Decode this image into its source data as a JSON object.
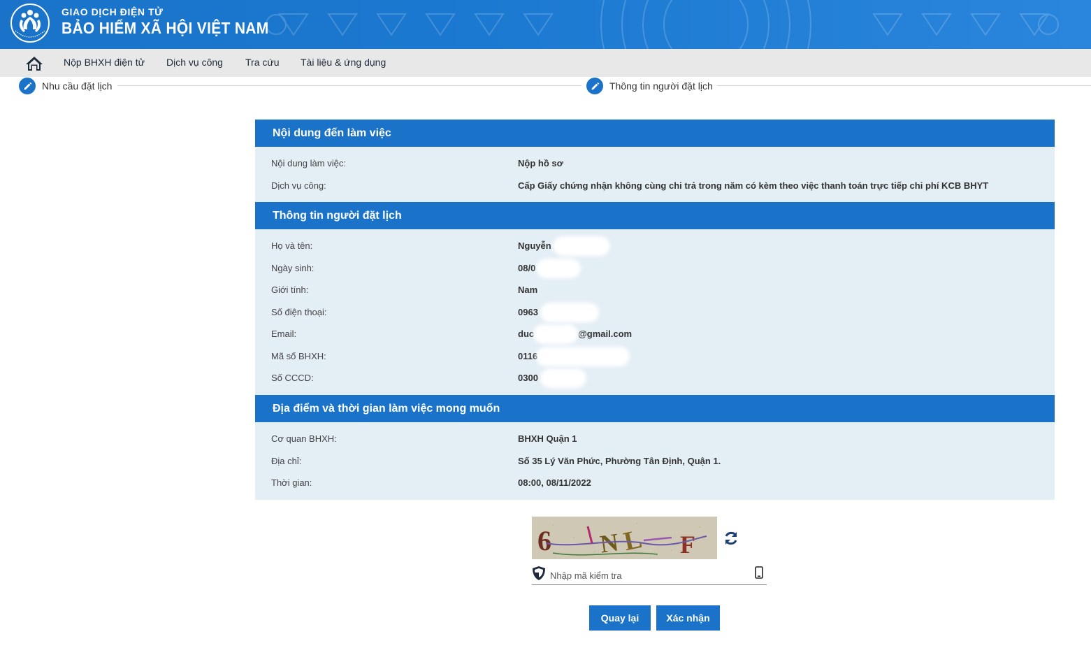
{
  "header": {
    "brand_top": "GIAO DỊCH ĐIỆN TỬ",
    "brand_main": "BẢO HIỂM XÃ HỘI VIỆT NAM",
    "logo_ring_text": "BẢO HIỂM XÃ HỘI VIỆT NAM",
    "color": "#1a73c8"
  },
  "nav": {
    "home_icon": "home-icon",
    "items": [
      "Nộp BHXH điện tử",
      "Dịch vụ công",
      "Tra cứu",
      "Tài liệu & ứng dụng"
    ]
  },
  "steps": [
    {
      "label": "Nhu cầu đặt lịch",
      "icon": "pencil-icon"
    },
    {
      "label": "Thông tin người đặt lịch",
      "icon": "pencil-icon"
    }
  ],
  "sections": [
    {
      "title": "Nội dung đến làm việc",
      "rows": [
        {
          "label": "Nội dung làm việc:",
          "value": "Nộp hồ sơ"
        },
        {
          "label": "Dịch vụ công:",
          "value": "Cấp Giấy chứng nhận không cùng chi trả trong năm có kèm theo việc thanh toán trực tiếp chi phí KCB BHYT"
        }
      ]
    },
    {
      "title": "Thông tin người đặt lịch",
      "rows": [
        {
          "label": "Họ và tên:",
          "value": "Nguyễn"
        },
        {
          "label": "Ngày sinh:",
          "value": "08/0"
        },
        {
          "label": "Giới tính:",
          "value": "Nam"
        },
        {
          "label": "Số điện thoại:",
          "value": "0963"
        },
        {
          "label": "Email:",
          "value": "duc",
          "value_suffix": "@gmail.com"
        },
        {
          "label": "Mã số BHXH:",
          "value": "0116"
        },
        {
          "label": "Số CCCD:",
          "value": "0300"
        }
      ]
    },
    {
      "title": "Địa điểm và thời gian làm việc mong muốn",
      "rows": [
        {
          "label": "Cơ quan BHXH:",
          "value": "BHXH Quận 1"
        },
        {
          "label": "Địa chỉ:",
          "value": "Số 35 Lý Văn Phức, Phường Tân Định, Quận 1."
        },
        {
          "label": "Thời gian:",
          "value": "08:00, 08/11/2022"
        }
      ]
    }
  ],
  "captcha": {
    "text": "6NLF",
    "placeholder": "Nhập mã kiểm tra",
    "value": "",
    "refresh_icon": "refresh-icon",
    "shield_icon": "shield-icon",
    "phone_icon": "phone-icon"
  },
  "buttons": {
    "back": "Quay lại",
    "confirm": "Xác nhận"
  }
}
